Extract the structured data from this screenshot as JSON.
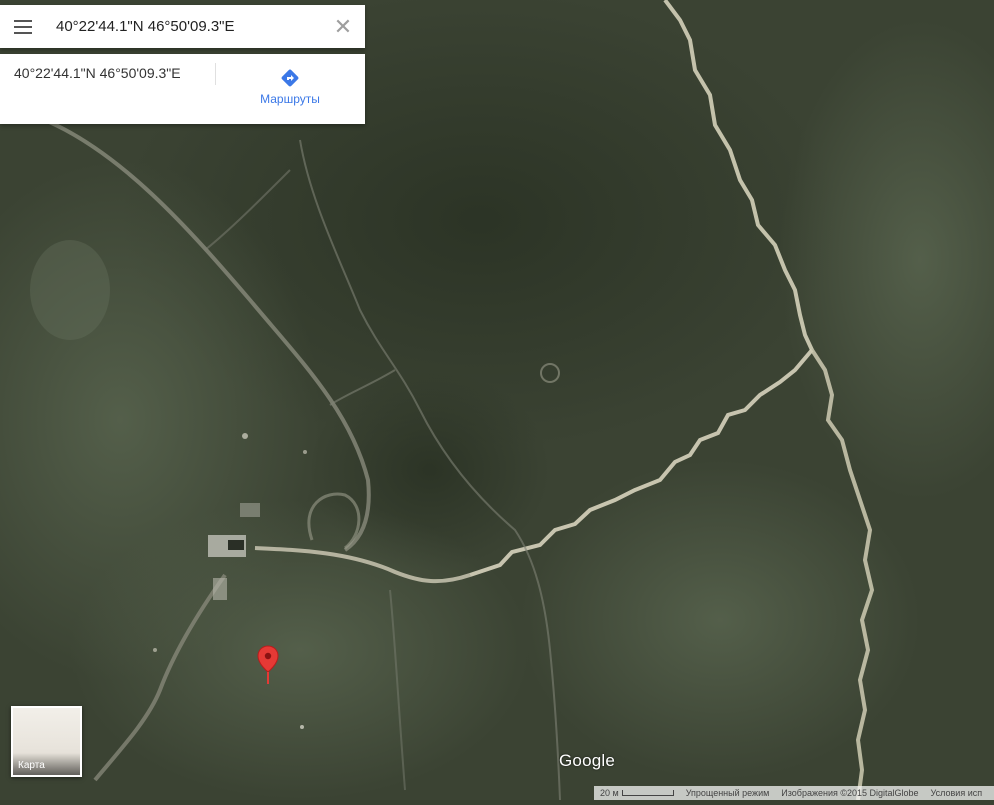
{
  "search": {
    "value": "40°22'44.1\"N 46°50'09.3\"E",
    "menu_icon": "hamburger-menu-icon",
    "clear_icon": "close-icon"
  },
  "place_card": {
    "coordinates": "40°22'44.1\"N 46°50'09.3\"E",
    "routes_label": "Маршруты",
    "routes_icon": "directions-icon"
  },
  "map": {
    "type": "satellite",
    "pin_color": "#e53935",
    "layer_toggle_label": "Карта"
  },
  "branding": {
    "logo_text": "Google"
  },
  "footer": {
    "scale_label": "20 м",
    "lite_mode": "Упрощенный режим",
    "imagery": "Изображения ©2015 DigitalGlobe",
    "terms": "Условия исп"
  }
}
